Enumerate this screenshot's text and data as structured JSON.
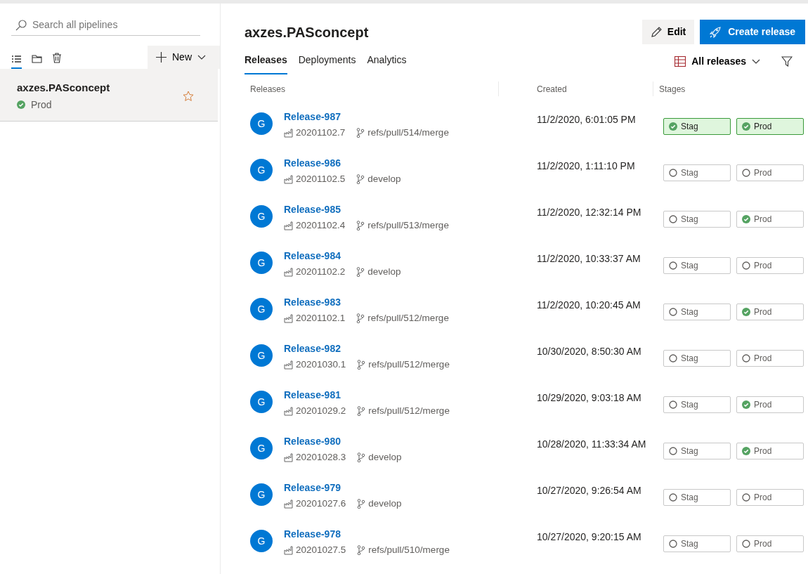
{
  "sidebar": {
    "search": {
      "placeholder": "Search all pipelines"
    },
    "view_tabs": [
      {
        "kind": "list",
        "selected": true
      },
      {
        "kind": "folder",
        "selected": false
      },
      {
        "kind": "trash",
        "selected": false
      }
    ],
    "new_button": {
      "label": "New"
    },
    "pipelines": [
      {
        "name": "axzes.PASconcept",
        "status": "Prod",
        "selected": true,
        "favorite": false
      }
    ]
  },
  "header": {
    "title": "axzes.PASconcept",
    "edit_button": "Edit",
    "create_button": "Create release"
  },
  "tabs": [
    {
      "label": "Releases",
      "selected": true
    },
    {
      "label": "Deployments",
      "selected": false
    },
    {
      "label": "Analytics",
      "selected": false
    }
  ],
  "view_filter": {
    "label": "All releases"
  },
  "table": {
    "columns": [
      "Releases",
      "Created",
      "Stages"
    ],
    "rows": [
      {
        "avatar": "G",
        "name": "Release-987",
        "build": "20201102.7",
        "branch": "refs/pull/514/merge",
        "created": "11/2/2020, 6:01:05 PM",
        "stages": [
          {
            "name": "Stag",
            "succeeded": true,
            "current": true
          },
          {
            "name": "Prod",
            "succeeded": true,
            "current": true
          }
        ]
      },
      {
        "avatar": "G",
        "name": "Release-986",
        "build": "20201102.5",
        "branch": "develop",
        "created": "11/2/2020, 1:11:10 PM",
        "stages": [
          {
            "name": "Stag",
            "succeeded": false,
            "current": false
          },
          {
            "name": "Prod",
            "succeeded": false,
            "current": false
          }
        ]
      },
      {
        "avatar": "G",
        "name": "Release-985",
        "build": "20201102.4",
        "branch": "refs/pull/513/merge",
        "created": "11/2/2020, 12:32:14 PM",
        "stages": [
          {
            "name": "Stag",
            "succeeded": false,
            "current": false
          },
          {
            "name": "Prod",
            "succeeded": true,
            "current": false
          }
        ]
      },
      {
        "avatar": "G",
        "name": "Release-984",
        "build": "20201102.2",
        "branch": "develop",
        "created": "11/2/2020, 10:33:37 AM",
        "stages": [
          {
            "name": "Stag",
            "succeeded": false,
            "current": false
          },
          {
            "name": "Prod",
            "succeeded": false,
            "current": false
          }
        ]
      },
      {
        "avatar": "G",
        "name": "Release-983",
        "build": "20201102.1",
        "branch": "refs/pull/512/merge",
        "created": "11/2/2020, 10:20:45 AM",
        "stages": [
          {
            "name": "Stag",
            "succeeded": false,
            "current": false
          },
          {
            "name": "Prod",
            "succeeded": true,
            "current": false
          }
        ]
      },
      {
        "avatar": "G",
        "name": "Release-982",
        "build": "20201030.1",
        "branch": "refs/pull/512/merge",
        "created": "10/30/2020, 8:50:30 AM",
        "stages": [
          {
            "name": "Stag",
            "succeeded": false,
            "current": false
          },
          {
            "name": "Prod",
            "succeeded": false,
            "current": false
          }
        ]
      },
      {
        "avatar": "G",
        "name": "Release-981",
        "build": "20201029.2",
        "branch": "refs/pull/512/merge",
        "created": "10/29/2020, 9:03:18 AM",
        "stages": [
          {
            "name": "Stag",
            "succeeded": false,
            "current": false
          },
          {
            "name": "Prod",
            "succeeded": true,
            "current": false
          }
        ]
      },
      {
        "avatar": "G",
        "name": "Release-980",
        "build": "20201028.3",
        "branch": "develop",
        "created": "10/28/2020, 11:33:34 AM",
        "stages": [
          {
            "name": "Stag",
            "succeeded": false,
            "current": false
          },
          {
            "name": "Prod",
            "succeeded": true,
            "current": false
          }
        ]
      },
      {
        "avatar": "G",
        "name": "Release-979",
        "build": "20201027.6",
        "branch": "develop",
        "created": "10/27/2020, 9:26:54 AM",
        "stages": [
          {
            "name": "Stag",
            "succeeded": false,
            "current": false
          },
          {
            "name": "Prod",
            "succeeded": false,
            "current": false
          }
        ]
      },
      {
        "avatar": "G",
        "name": "Release-978",
        "build": "20201027.5",
        "branch": "refs/pull/510/merge",
        "created": "10/27/2020, 9:20:15 AM",
        "stages": [
          {
            "name": "Stag",
            "succeeded": false,
            "current": false
          },
          {
            "name": "Prod",
            "succeeded": false,
            "current": false
          }
        ]
      }
    ]
  }
}
